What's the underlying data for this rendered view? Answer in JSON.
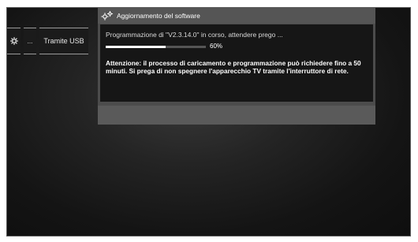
{
  "menu": {
    "gear_icon": "gear-icon",
    "dots_label": "...",
    "usb_label": "Tramite USB"
  },
  "dialog": {
    "icon": "gears-icon",
    "title": "Aggiornamento del software",
    "status": "Programmazione di \"V2.3.14.0\" in corso, attendere prego ...",
    "progress_percent": 60,
    "progress_label": "60%",
    "warning": "Attenzione: il processo di caricamento e programmazione può richiedere fino a 50 minuti. Si prega di non spegnere l'apparecchio TV tramite l'interruttore di rete."
  },
  "colors": {
    "panel": "#4c4c4c",
    "panel_body": "#161616",
    "progress_fill": "#ffffff"
  }
}
